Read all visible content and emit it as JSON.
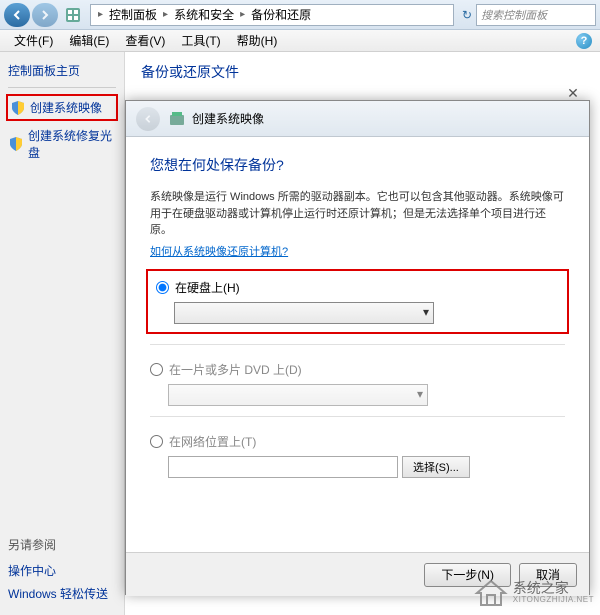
{
  "titlebar": {
    "breadcrumb": [
      "控制面板",
      "系统和安全",
      "备份和还原"
    ],
    "search_placeholder": "搜索控制面板"
  },
  "menubar": {
    "items": [
      "文件(F)",
      "编辑(E)",
      "查看(V)",
      "工具(T)",
      "帮助(H)"
    ]
  },
  "sidebar": {
    "title": "控制面板主页",
    "links": [
      {
        "label": "创建系统映像"
      },
      {
        "label": "创建系统修复光盘"
      }
    ],
    "footer_title": "另请参阅",
    "footer_links": [
      "操作中心",
      "Windows 轻松传送"
    ]
  },
  "content": {
    "title": "备份或还原文件"
  },
  "dialog": {
    "title": "创建系统映像",
    "heading": "您想在何处保存备份?",
    "description": "系统映像是运行 Windows 所需的驱动器副本。它也可以包含其他驱动器。系统映像可用于在硬盘驱动器或计算机停止运行时还原计算机；但是无法选择单个项目进行还原。",
    "help_link": "如何从系统映像还原计算机?",
    "options": {
      "hard_disk": "在硬盘上(H)",
      "dvd": "在一片或多片 DVD 上(D)",
      "network": "在网络位置上(T)"
    },
    "browse_btn": "选择(S)...",
    "next_btn": "下一步(N)",
    "cancel_btn": "取消"
  },
  "watermark": {
    "text": "系统之家",
    "sub": "XITONGZHIJIA.NET"
  }
}
